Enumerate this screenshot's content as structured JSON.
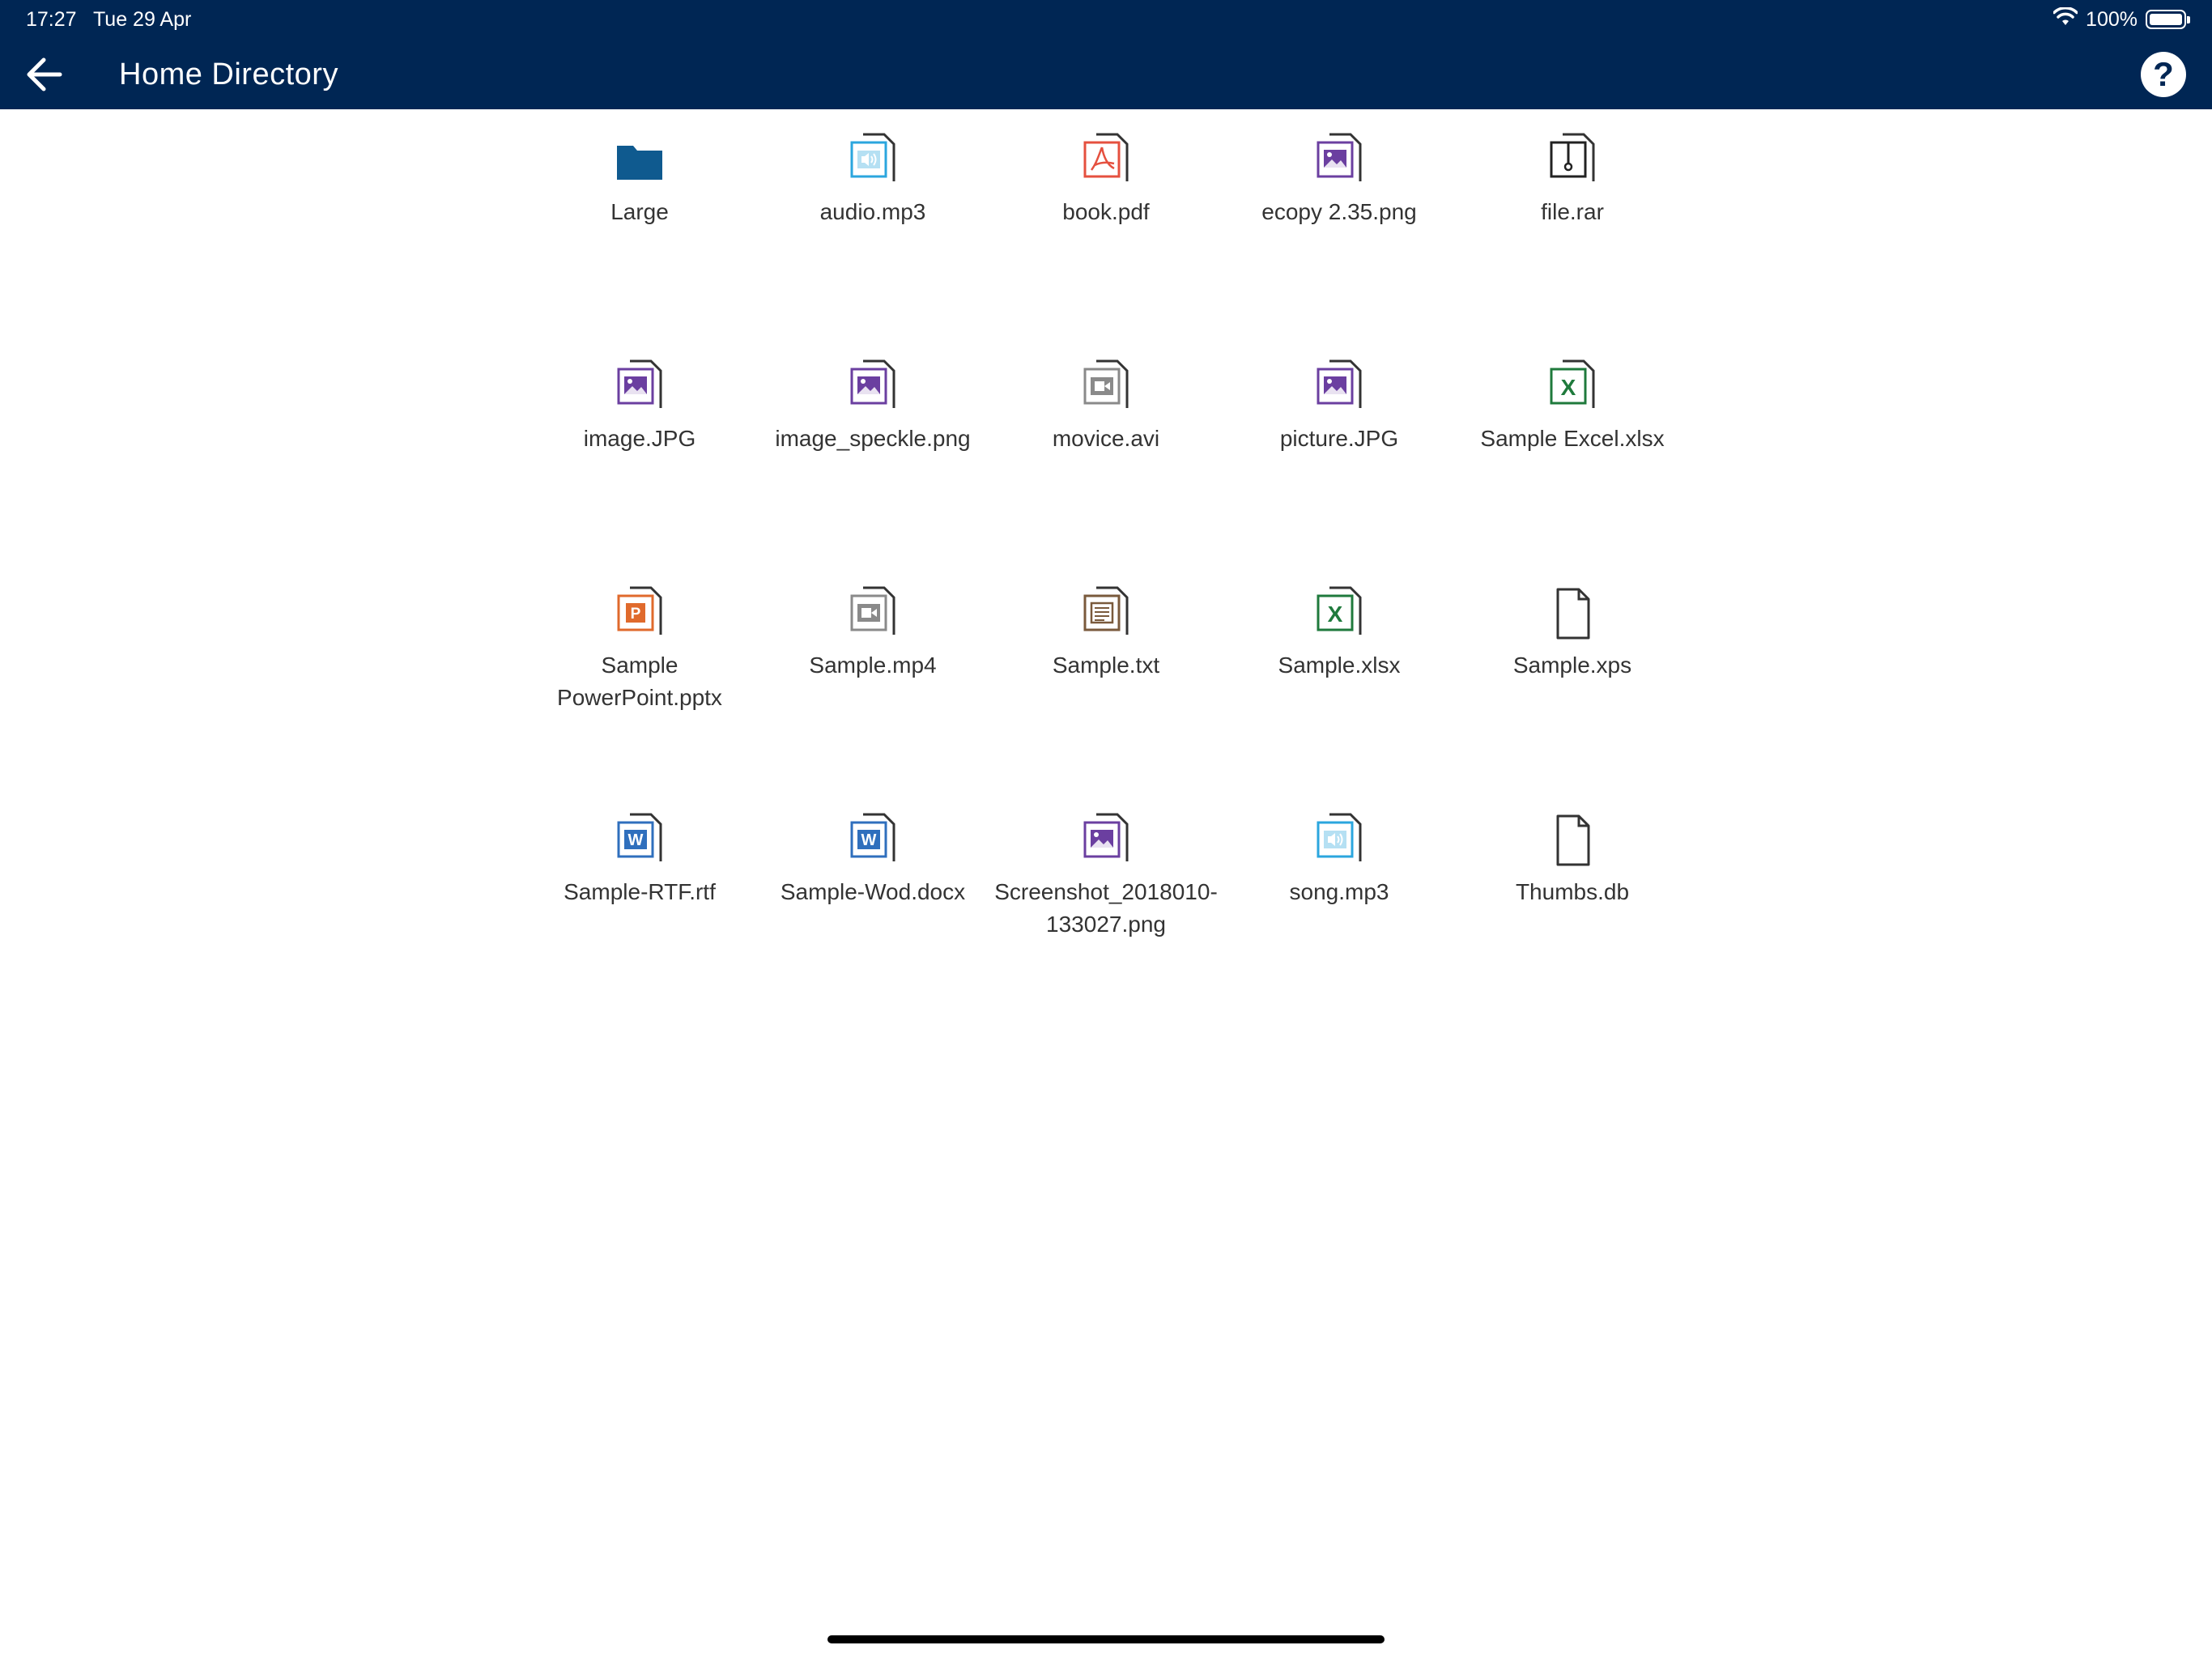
{
  "status_bar": {
    "time": "17:27",
    "date": "Tue 29 Apr",
    "battery": "100%",
    "battery_level": 1.0
  },
  "header": {
    "title": "Home Directory",
    "back_icon": "arrow-left-icon",
    "help_icon": "question-mark-icon",
    "help_label": "?",
    "background": "#002654"
  },
  "files": [
    {
      "name": "Large",
      "type": "folder",
      "icon": "folder-icon",
      "color": "#0f5a8f"
    },
    {
      "name": "audio.mp3",
      "type": "audio",
      "icon": "audio-file-icon",
      "color": "#2ba6de"
    },
    {
      "name": "book.pdf",
      "type": "pdf",
      "icon": "pdf-file-icon",
      "color": "#e5503f"
    },
    {
      "name": "ecopy 2.35.png",
      "type": "image",
      "icon": "image-file-icon",
      "color": "#6b3fa0"
    },
    {
      "name": "file.rar",
      "type": "archive",
      "icon": "archive-file-icon",
      "color": "#222222"
    },
    {
      "name": "image.JPG",
      "type": "image",
      "icon": "image-file-icon",
      "color": "#6b3fa0"
    },
    {
      "name": "image_speckle.png",
      "type": "image",
      "icon": "image-file-icon",
      "color": "#6b3fa0"
    },
    {
      "name": "movice.avi",
      "type": "video",
      "icon": "video-file-icon",
      "color": "#8a8a8a"
    },
    {
      "name": "picture.JPG",
      "type": "image",
      "icon": "image-file-icon",
      "color": "#6b3fa0"
    },
    {
      "name": "Sample Excel.xlsx",
      "type": "excel",
      "icon": "excel-file-icon",
      "color": "#1f7a3c"
    },
    {
      "name": "Sample\nPowerPoint.pptx",
      "type": "powerpoint",
      "icon": "powerpoint-file-icon",
      "color": "#e06a2c"
    },
    {
      "name": "Sample.mp4",
      "type": "video",
      "icon": "video-file-icon",
      "color": "#8a8a8a"
    },
    {
      "name": "Sample.txt",
      "type": "text",
      "icon": "text-file-icon",
      "color": "#7a5a3c"
    },
    {
      "name": "Sample.xlsx",
      "type": "excel",
      "icon": "excel-file-icon",
      "color": "#1f7a3c"
    },
    {
      "name": "Sample.xps",
      "type": "generic",
      "icon": "generic-file-icon",
      "color": "#333333"
    },
    {
      "name": "Sample-RTF.rtf",
      "type": "word",
      "icon": "word-file-icon",
      "color": "#2f6fbd"
    },
    {
      "name": "Sample-Wod.docx",
      "type": "word",
      "icon": "word-file-icon",
      "color": "#2f6fbd"
    },
    {
      "name": "Screenshot_2018010-\n133027.png",
      "type": "image",
      "icon": "image-file-icon",
      "color": "#6b3fa0"
    },
    {
      "name": "song.mp3",
      "type": "audio",
      "icon": "audio-file-icon",
      "color": "#2ba6de"
    },
    {
      "name": "Thumbs.db",
      "type": "generic",
      "icon": "generic-file-icon",
      "color": "#333333"
    }
  ]
}
